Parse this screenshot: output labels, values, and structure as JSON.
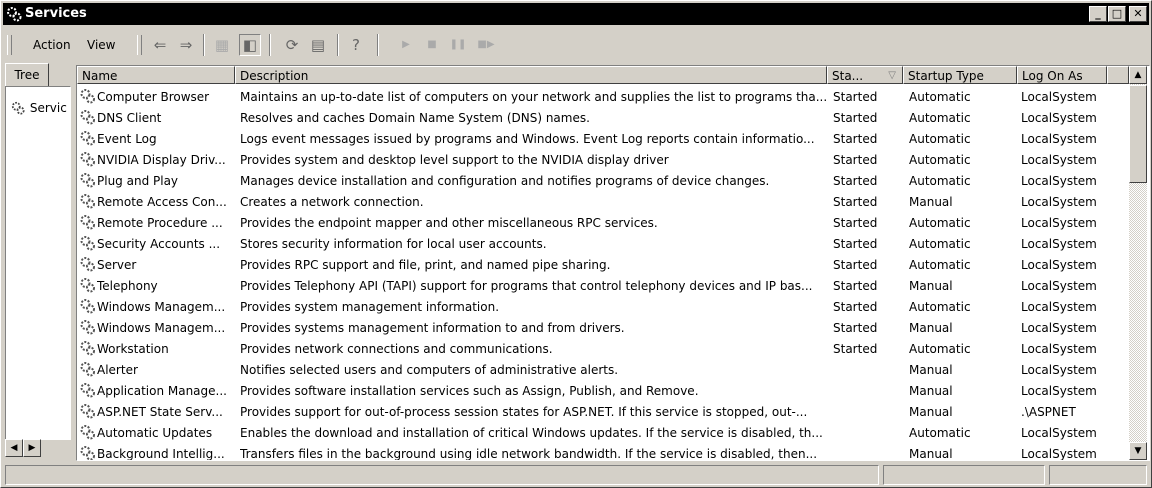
{
  "window": {
    "title": "Services",
    "buttons": {
      "minimize": "_",
      "maximize": "□",
      "close": "✕"
    }
  },
  "menu": {
    "action": "Action",
    "view": "View"
  },
  "toolbar_icons": [
    "back-icon",
    "forward-icon",
    "up-icon",
    "show-hide-tree-icon",
    "refresh-icon",
    "export-list-icon",
    "help-icon",
    "start-service-icon",
    "stop-service-icon",
    "pause-service-icon",
    "restart-service-icon"
  ],
  "tree": {
    "tab_label": "Tree",
    "node_label": "Servic"
  },
  "columns": {
    "name": "Name",
    "description": "Description",
    "status": "Sta...",
    "startup": "Startup Type",
    "logon": "Log On As"
  },
  "services": [
    {
      "name": "Computer Browser",
      "description": "Maintains an up-to-date list of computers on your network and supplies the list to programs tha...",
      "status": "Started",
      "startup": "Automatic",
      "logon": "LocalSystem"
    },
    {
      "name": "DNS Client",
      "description": "Resolves and caches Domain Name System (DNS) names.",
      "status": "Started",
      "startup": "Automatic",
      "logon": "LocalSystem"
    },
    {
      "name": "Event Log",
      "description": "Logs event messages issued by programs and Windows.  Event Log reports contain informatio...",
      "status": "Started",
      "startup": "Automatic",
      "logon": "LocalSystem"
    },
    {
      "name": "NVIDIA Display Driv...",
      "description": "Provides system and desktop level support to the NVIDIA display driver",
      "status": "Started",
      "startup": "Automatic",
      "logon": "LocalSystem"
    },
    {
      "name": "Plug and Play",
      "description": "Manages device installation and configuration and notifies programs of device changes.",
      "status": "Started",
      "startup": "Automatic",
      "logon": "LocalSystem"
    },
    {
      "name": "Remote Access Con...",
      "description": "Creates a network connection.",
      "status": "Started",
      "startup": "Manual",
      "logon": "LocalSystem"
    },
    {
      "name": "Remote Procedure ...",
      "description": "Provides the endpoint mapper and other miscellaneous RPC services.",
      "status": "Started",
      "startup": "Automatic",
      "logon": "LocalSystem"
    },
    {
      "name": "Security Accounts ...",
      "description": "Stores security information for local user accounts.",
      "status": "Started",
      "startup": "Automatic",
      "logon": "LocalSystem"
    },
    {
      "name": "Server",
      "description": "Provides RPC support and file, print, and named pipe sharing.",
      "status": "Started",
      "startup": "Automatic",
      "logon": "LocalSystem"
    },
    {
      "name": "Telephony",
      "description": "Provides Telephony API (TAPI) support for programs that control telephony devices and IP bas...",
      "status": "Started",
      "startup": "Manual",
      "logon": "LocalSystem"
    },
    {
      "name": "Windows Managem...",
      "description": "Provides system management information.",
      "status": "Started",
      "startup": "Automatic",
      "logon": "LocalSystem"
    },
    {
      "name": "Windows Managem...",
      "description": "Provides systems management information to and from drivers.",
      "status": "Started",
      "startup": "Manual",
      "logon": "LocalSystem"
    },
    {
      "name": "Workstation",
      "description": "Provides network connections and communications.",
      "status": "Started",
      "startup": "Automatic",
      "logon": "LocalSystem"
    },
    {
      "name": "Alerter",
      "description": "Notifies selected users and computers of administrative alerts.",
      "status": "",
      "startup": "Manual",
      "logon": "LocalSystem"
    },
    {
      "name": "Application Manage...",
      "description": "Provides software installation services such as Assign, Publish, and Remove.",
      "status": "",
      "startup": "Manual",
      "logon": "LocalSystem"
    },
    {
      "name": "ASP.NET State Serv...",
      "description": "Provides support for out-of-process session states for ASP.NET. If this service is stopped, out-...",
      "status": "",
      "startup": "Manual",
      "logon": ".\\ASPNET"
    },
    {
      "name": "Automatic Updates",
      "description": "Enables the download and installation of critical Windows updates. If the service is disabled, th...",
      "status": "",
      "startup": "Automatic",
      "logon": "LocalSystem"
    },
    {
      "name": "Background Intellig...",
      "description": "Transfers files in the background using idle network bandwidth. If the service is disabled, then...",
      "status": "",
      "startup": "Manual",
      "logon": "LocalSystem"
    }
  ],
  "colors": {
    "titlebar": "#000000",
    "face": "#d4d0c8",
    "list_bg": "#ffffff"
  }
}
